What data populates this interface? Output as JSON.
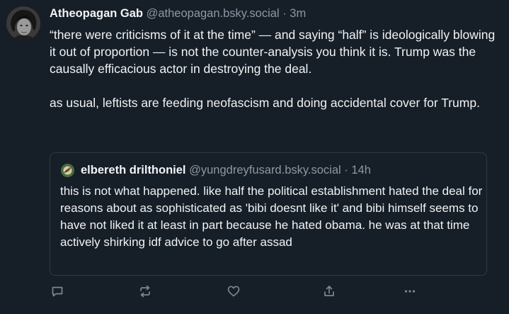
{
  "post": {
    "author": {
      "display_name": "Atheopagan Gab",
      "handle": "@atheopagan.bsky.social",
      "separator": "·",
      "time": "3m"
    },
    "paragraphs": [
      "“there were criticisms of it at the time” — and saying “half” is ideologically blowing it out of proportion — is not the counter-analysis you think it is. Trump was the causally efficacious actor in destroying the deal.",
      "as usual, leftists are feeding neofascism and doing accidental cover for Trump."
    ]
  },
  "quote": {
    "author": {
      "display_name": "elbereth drilthoniel",
      "handle": "@yungdreyfusard.bsky.social",
      "separator": "·",
      "time": "14h"
    },
    "text": "this is not what happened. like half the political establishment hated the deal for reasons about as sophisticated as 'bibi doesnt like it' and bibi himself seems to have not liked it at least in part because he hated obama. he was at that time actively shirking idf advice to go after assad"
  },
  "actions": {
    "icons": [
      "reply-icon",
      "repost-icon",
      "like-icon",
      "share-icon",
      "more-icon"
    ],
    "icon_color": "#7b8794"
  },
  "colors": {
    "background": "#161e27",
    "text": "#f1f3f5",
    "muted": "#8b98a5",
    "border": "#2e3a48"
  }
}
